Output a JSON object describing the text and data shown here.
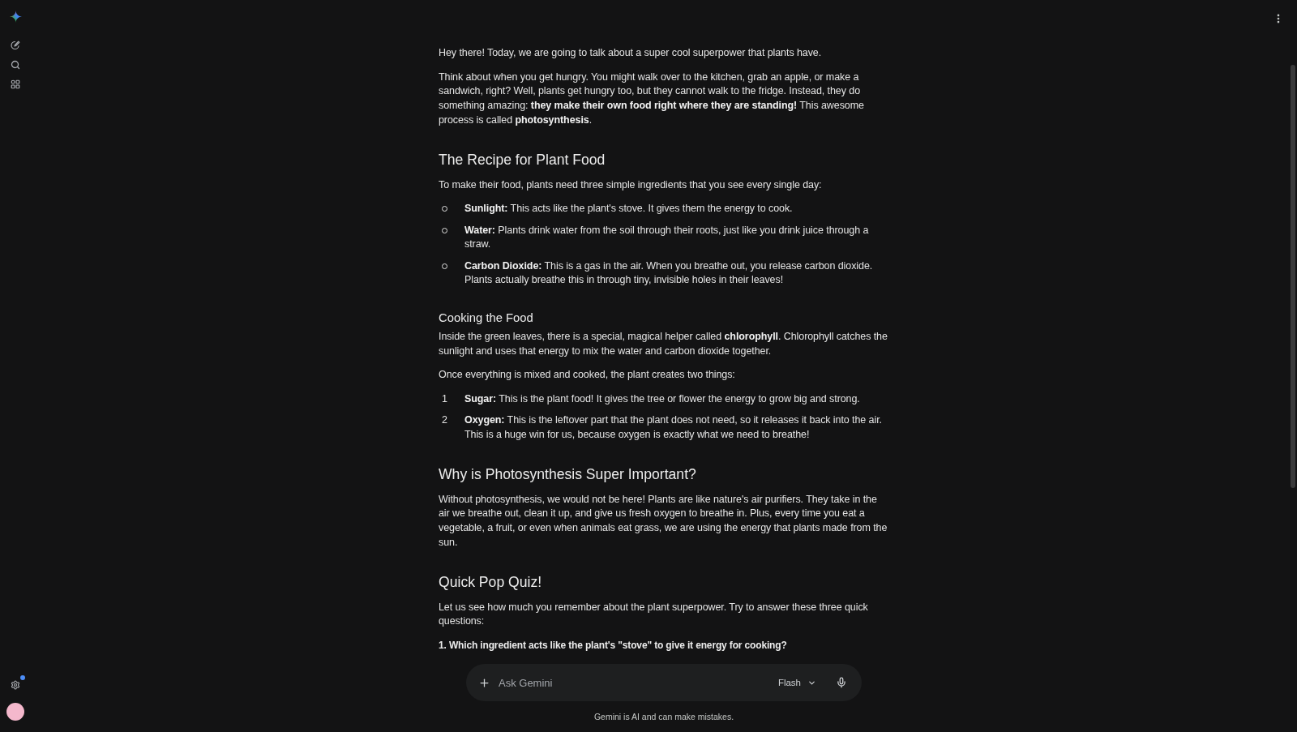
{
  "sidebar": {
    "settings_notification": true
  },
  "response": {
    "blocks": [
      {
        "kind": "paragraph",
        "text": "Hey there! Today, we are going to talk about a super cool superpower that plants have."
      },
      {
        "kind": "paragraph",
        "text": "Think about when you get hungry. You might walk over to the kitchen, grab an apple, or make a sandwich, right? Well, plants get hungry too, but they cannot walk to the fridge. Instead, they do something amazing: **they make their own food right where they are standing!** This awesome process is called **photosynthesis**."
      },
      {
        "kind": "heading",
        "text": "The Recipe for Plant Food"
      },
      {
        "kind": "paragraph",
        "text": "To make their food, plants need three simple ingredients that you see every single day:"
      },
      {
        "kind": "bullet_list",
        "items": [
          {
            "text": "**Sunlight:** This acts like the plant's stove. It gives them the energy to cook."
          },
          {
            "text": "**Water:** Plants drink water from the soil through their roots, just like you drink juice through a straw."
          },
          {
            "text": "**Carbon Dioxide:** This is a gas in the air. When you breathe out, you release carbon dioxide. Plants actually breathe this in through tiny, invisible holes in their leaves!"
          }
        ]
      },
      {
        "kind": "subheading",
        "text": "Cooking the Food"
      },
      {
        "kind": "paragraph",
        "text": "Inside the green leaves, there is a special, magical helper called **chlorophyll**. Chlorophyll catches the sunlight and uses that energy to mix the water and carbon dioxide together."
      },
      {
        "kind": "paragraph",
        "text": "Once everything is mixed and cooked, the plant creates two things:"
      },
      {
        "kind": "numbered_list",
        "items": [
          {
            "number": "1",
            "text": "**Sugar:** This is the plant food! It gives the tree or flower the energy to grow big and strong."
          },
          {
            "number": "2",
            "text": "**Oxygen:** This is the leftover part that the plant does not need, so it releases it back into the air. This is a huge win for us, because oxygen is exactly what we need to breathe!"
          }
        ]
      },
      {
        "kind": "heading",
        "text": "Why is Photosynthesis Super Important?"
      },
      {
        "kind": "paragraph",
        "text": "Without photosynthesis, we would not be here! Plants are like nature's air purifiers. They take in the air we breathe out, clean it up, and give us fresh oxygen to breathe in. Plus, every time you eat a vegetable, a fruit, or even when animals eat grass, we are using the energy that plants made from the sun."
      },
      {
        "kind": "heading",
        "text": "Quick Pop Quiz!"
      },
      {
        "kind": "paragraph",
        "text": "Let us see how much you remember about the plant superpower. Try to answer these three quick questions:"
      },
      {
        "kind": "question",
        "text": "1. Which ingredient acts like the plant's \"stove\" to give it energy for cooking?"
      }
    ]
  },
  "composer": {
    "placeholder": "Ask Gemini",
    "model": "Flash"
  },
  "disclaimer": "Gemini is AI and can make mistakes."
}
